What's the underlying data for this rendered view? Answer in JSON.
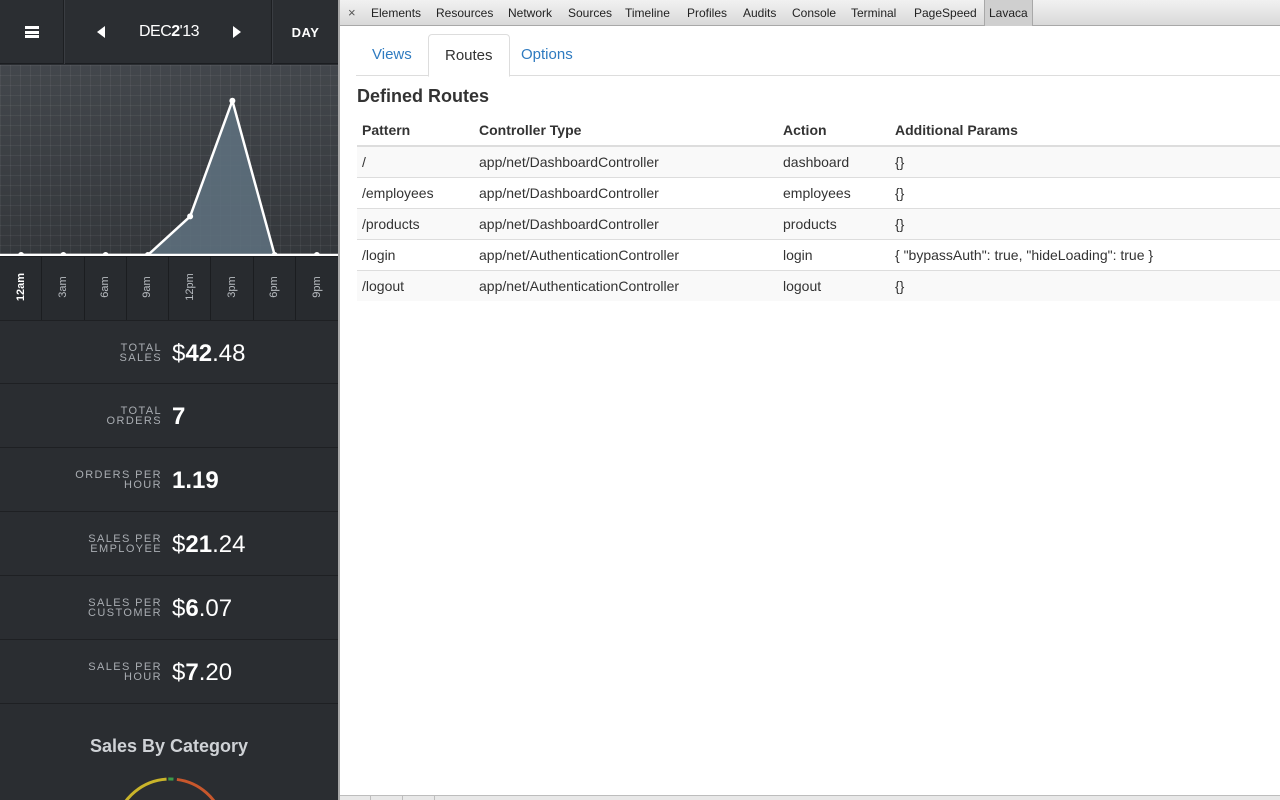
{
  "app": {
    "menu_icon": "hamburger-menu-icon",
    "date": {
      "month": "DEC",
      "day": "2",
      "year": "'13"
    },
    "prev_icon": "chevron-left-icon",
    "next_icon": "chevron-right-icon",
    "range_label": "DAY",
    "chart_data": {
      "type": "line",
      "x": [
        "12am",
        "3am",
        "6am",
        "9am",
        "12pm",
        "3pm",
        "6pm",
        "9pm"
      ],
      "series": [
        {
          "values": [
            0,
            0,
            0,
            0,
            6,
            24,
            0,
            0
          ]
        }
      ],
      "ylim": [
        0,
        28
      ],
      "line_color": "#ffffff",
      "fill_color": "#5f7280",
      "grid": true,
      "bold_tick": "12am"
    },
    "stats": [
      {
        "label_lines": [
          "TOTAL",
          "SALES"
        ],
        "prefix": "$",
        "int": "42",
        "dec": ".48"
      },
      {
        "label_lines": [
          "TOTAL",
          "ORDERS"
        ],
        "prefix": "",
        "int": "7",
        "dec": ""
      },
      {
        "label_lines": [
          "ORDERS PER",
          "HOUR"
        ],
        "prefix": "",
        "int": "1.19",
        "dec": ""
      },
      {
        "label_lines": [
          "SALES PER",
          "EMPLOYEE"
        ],
        "prefix": "$",
        "int": "21",
        "dec": ".24"
      },
      {
        "label_lines": [
          "SALES PER",
          "CUSTOMER"
        ],
        "prefix": "$",
        "int": "6",
        "dec": ".07"
      },
      {
        "label_lines": [
          "SALES PER",
          "HOUR"
        ],
        "prefix": "$",
        "int": "7",
        "dec": ".20"
      }
    ],
    "category_title": "Sales By Category",
    "donut_colors": [
      "#c9b42a",
      "#3d9a4a",
      "#c8572c"
    ]
  },
  "devtools": {
    "close_icon": "close-icon",
    "close_glyph": "×",
    "tabs": [
      "Elements",
      "Resources",
      "Network",
      "Sources",
      "Timeline",
      "Profiles",
      "Audits",
      "Console",
      "Terminal",
      "PageSpeed",
      "Lavaca"
    ],
    "selected_tab": "Lavaca",
    "sub_tabs": [
      "Views",
      "Routes",
      "Options"
    ],
    "active_sub_tab": "Routes",
    "section_title": "Defined Routes",
    "table": {
      "headers": [
        "Pattern",
        "Controller Type",
        "Action",
        "Additional Params"
      ],
      "rows": [
        [
          "/",
          "app/net/DashboardController",
          "dashboard",
          "{}"
        ],
        [
          "/employees",
          "app/net/DashboardController",
          "employees",
          "{}"
        ],
        [
          "/products",
          "app/net/DashboardController",
          "products",
          "{}"
        ],
        [
          "/login",
          "app/net/AuthenticationController",
          "login",
          "{ \"bypassAuth\": true, \"hideLoading\": true }"
        ],
        [
          "/logout",
          "app/net/AuthenticationController",
          "logout",
          "{}"
        ]
      ]
    }
  }
}
